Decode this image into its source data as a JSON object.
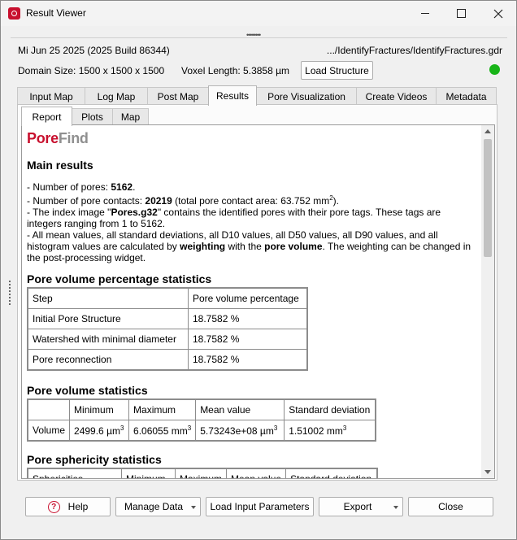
{
  "window": {
    "title": "Result Viewer"
  },
  "info": {
    "build": "Mi Jun 25 2025 (2025 Build 86344)",
    "path": ".../IdentifyFractures/IdentifyFractures.gdr",
    "domain_size": "Domain Size: 1500 x 1500 x 1500",
    "voxel_length": "Voxel Length: 5.3858 µm",
    "load_structure": "Load Structure",
    "status_color": "#18b418"
  },
  "main_tabs": [
    {
      "label": "Input Map"
    },
    {
      "label": "Log Map"
    },
    {
      "label": "Post Map"
    },
    {
      "label": "Results"
    },
    {
      "label": "Pore Visualization"
    },
    {
      "label": "Create Videos"
    },
    {
      "label": "Metadata"
    }
  ],
  "sub_tabs": [
    {
      "label": "Report"
    },
    {
      "label": "Plots"
    },
    {
      "label": "Map"
    }
  ],
  "report": {
    "logo_part1": "Pore",
    "logo_part2": "Find",
    "main_heading": "Main results",
    "b1_pre": "- Number of pores: ",
    "b1_val": "5162",
    "b1_post": ".",
    "b2_pre": "- Number of pore contacts: ",
    "b2_val": "20219",
    "b2_post": " (total pore contact area: 63.752 mm",
    "b2_sup": "2",
    "b2_end": ").",
    "b3_pre": "- The index image \"",
    "b3_val": "Pores.g32",
    "b3_post": "\" contains the identified pores with their pore tags. These tags are integers ranging from 1 to 5162.",
    "b4_pre": "- All mean values, all standard deviations, all D10 values, all D50 values, all D90 values, and all histogram values are calculated by ",
    "b4_val1": "weighting",
    "b4_mid": " with the ",
    "b4_val2": "pore volume",
    "b4_post": ". The weighting can be changed in the post-processing widget.",
    "sec1_title": "Pore volume percentage statistics",
    "sec1_headers": [
      "Step",
      "Pore volume percentage"
    ],
    "sec1_rows": [
      [
        "Initial Pore Structure",
        "18.7582 %"
      ],
      [
        "Watershed with minimal diameter",
        "18.7582 %"
      ],
      [
        "Pore reconnection",
        "18.7582 %"
      ]
    ],
    "sec2_title": "Pore volume statistics",
    "sec2_headers": [
      "",
      "Minimum",
      "Maximum",
      "Mean value",
      "Standard deviation"
    ],
    "sec2_row_label": "Volume",
    "sec2_min": "2499.6 µm",
    "sec2_max": "6.06055 mm",
    "sec2_mean": "5.73243e+08 µm",
    "sec2_std": "1.51002 mm",
    "sec2_sup": "3",
    "sec3_title": "Pore sphericity statistics",
    "sec3_headers": [
      "Sphericities",
      "Minimum",
      "Maximum",
      "Mean value",
      "Standard deviation"
    ]
  },
  "buttons": {
    "help": "Help",
    "manage_data": "Manage Data",
    "load_input_params": "Load Input Parameters",
    "export": "Export",
    "close": "Close"
  }
}
